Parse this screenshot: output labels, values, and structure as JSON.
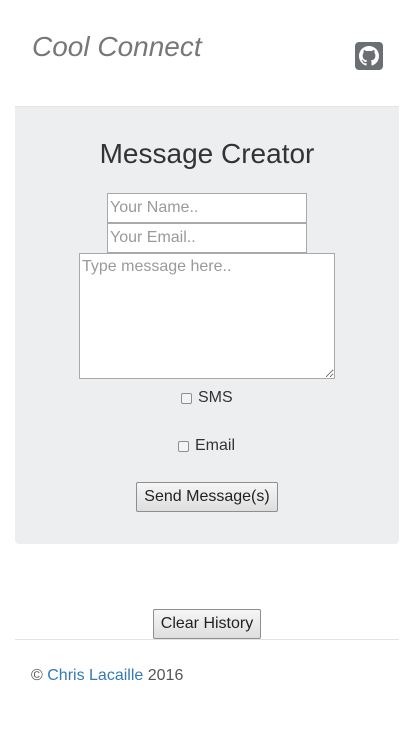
{
  "header": {
    "brand": "Cool Connect",
    "github_icon": "github-icon"
  },
  "creator": {
    "title": "Message Creator",
    "name_placeholder": "Your Name..",
    "email_placeholder": "Your Email..",
    "message_placeholder": "Type message here..",
    "sms_label": "SMS",
    "email_label": "Email",
    "send_label": "Send Message(s)"
  },
  "actions": {
    "clear_history_label": "Clear History"
  },
  "footer": {
    "copyright_symbol": "©",
    "author": "Chris Lacaille",
    "year": "2016"
  },
  "colors": {
    "brand_text": "#777777",
    "card_background": "#eceeef",
    "link": "#337ab7",
    "github_button": "#6b6f73"
  }
}
